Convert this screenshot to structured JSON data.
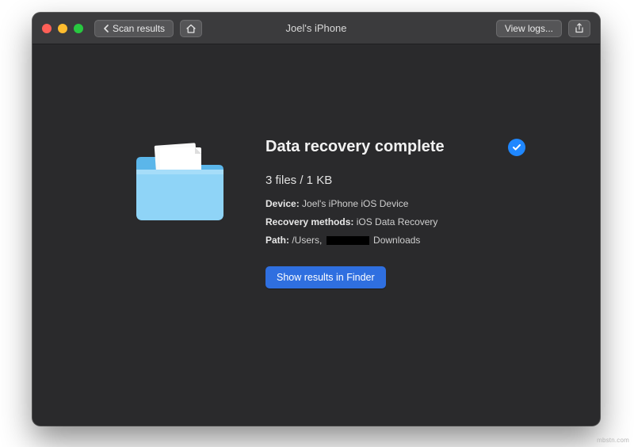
{
  "titlebar": {
    "back_label": "Scan results",
    "title": "Joel's iPhone",
    "view_logs_label": "View logs..."
  },
  "main": {
    "heading": "Data recovery complete",
    "summary": "3 files / 1 KB",
    "device_label": "Device:",
    "device_value": "Joel's iPhone iOS Device",
    "methods_label": "Recovery methods:",
    "methods_value": "iOS Data Recovery",
    "path_label": "Path:",
    "path_prefix": "/Users,",
    "path_suffix": "Downloads",
    "cta_label": "Show results in Finder"
  },
  "watermark": "mbstn.com"
}
